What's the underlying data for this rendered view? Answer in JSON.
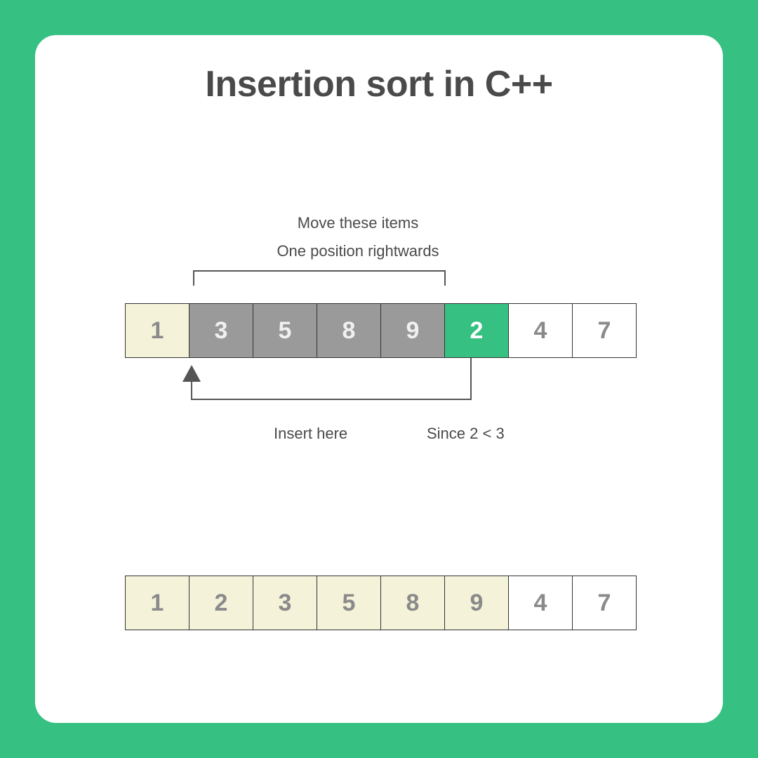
{
  "title": "Insertion sort in C++",
  "annotations": {
    "move_line1": "Move these items",
    "move_line2": "One position rightwards",
    "insert_here": "Insert here",
    "since": "Since 2 < 3"
  },
  "array_top": [
    {
      "value": "1",
      "style": "cream"
    },
    {
      "value": "3",
      "style": "gray"
    },
    {
      "value": "5",
      "style": "gray"
    },
    {
      "value": "8",
      "style": "gray"
    },
    {
      "value": "9",
      "style": "gray"
    },
    {
      "value": "2",
      "style": "green"
    },
    {
      "value": "4",
      "style": "white"
    },
    {
      "value": "7",
      "style": "white"
    }
  ],
  "array_bottom": [
    {
      "value": "1",
      "style": "cream"
    },
    {
      "value": "2",
      "style": "cream"
    },
    {
      "value": "3",
      "style": "cream"
    },
    {
      "value": "5",
      "style": "cream"
    },
    {
      "value": "8",
      "style": "cream"
    },
    {
      "value": "9",
      "style": "cream"
    },
    {
      "value": "4",
      "style": "white"
    },
    {
      "value": "7",
      "style": "white"
    }
  ]
}
